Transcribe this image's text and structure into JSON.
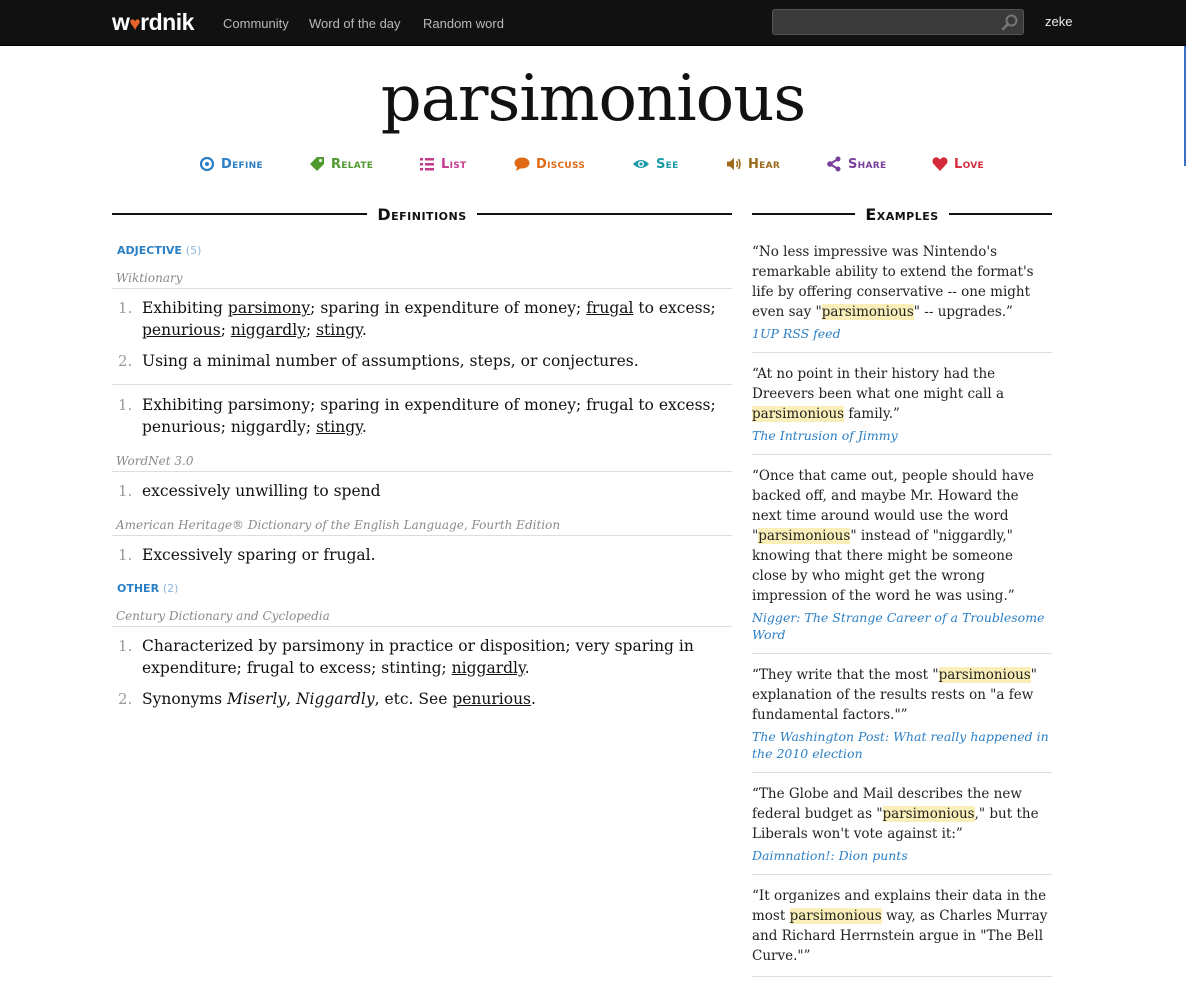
{
  "header": {
    "logo": {
      "pre": "w",
      "heart": "♥",
      "post": "rdnik"
    },
    "nav": [
      "Community",
      "Word of the day",
      "Random word"
    ],
    "search": {
      "value": "",
      "placeholder": ""
    },
    "user": "zeke"
  },
  "word": "parsimonious",
  "actions": [
    {
      "label": "Define",
      "icon": "target-icon",
      "color": "#2b7fc5"
    },
    {
      "label": "Relate",
      "icon": "tag-icon",
      "color": "#4f9a2e"
    },
    {
      "label": "List",
      "icon": "list-icon",
      "color": "#c43a8c"
    },
    {
      "label": "Discuss",
      "icon": "speech-bubble-icon",
      "color": "#e06a14"
    },
    {
      "label": "See",
      "icon": "eye-icon",
      "color": "#1a9aa5"
    },
    {
      "label": "Hear",
      "icon": "speaker-icon",
      "color": "#9b6a1c"
    },
    {
      "label": "Share",
      "icon": "share-icon",
      "color": "#7a3f9c"
    },
    {
      "label": "Love",
      "icon": "heart-icon",
      "color": "#d42a3a"
    }
  ],
  "definitions_heading": "Definitions",
  "examples_heading": "Examples",
  "definitions": {
    "adjective": {
      "pos": "adjective",
      "count": "(5)",
      "wiktionary": {
        "source": "Wiktionary",
        "group1": [
          {
            "num": "1.",
            "a": "Exhibiting ",
            "l1": "parsimony",
            "b": "; sparing in expenditure of money; ",
            "l2": "frugal",
            "c": " to excess; ",
            "l3": "penurious",
            "d": "; ",
            "l4": "niggardly",
            "e": "; ",
            "l5": "stingy",
            "f": "."
          },
          {
            "num": "2.",
            "text": "Using a minimal number of assumptions, steps, or conjectures."
          }
        ],
        "group2": [
          {
            "num": "1.",
            "a": "Exhibiting parsimony; sparing in expenditure of money; frugal to excess; penurious; niggardly; ",
            "l1": "stingy",
            "b": "."
          }
        ]
      },
      "wordnet": {
        "source": "WordNet 3.0",
        "items": [
          {
            "num": "1.",
            "text": "excessively unwilling to spend"
          }
        ]
      },
      "ahd": {
        "source": "American Heritage® Dictionary of the English Language, Fourth Edition",
        "items": [
          {
            "num": "1.",
            "text": "Excessively sparing or frugal."
          }
        ]
      }
    },
    "other": {
      "pos": "other",
      "count": "(2)",
      "century": {
        "source": "Century Dictionary and Cyclopedia",
        "item1": {
          "num": "1.",
          "a": "Characterized by parsimony in practice or disposition; very sparing in expenditure; frugal to excess; stinting; ",
          "l1": "niggardly",
          "b": "."
        },
        "item2": {
          "num": "2.",
          "a": "Synonyms ",
          "i1": "Miserly",
          "sep": ", ",
          "i2": "Niggardly",
          "b": ", etc. See ",
          "l1": "penurious",
          "c": "."
        }
      }
    }
  },
  "examples": [
    {
      "pre": "“No less impressive was Nintendo's remarkable ability to extend the format's life by offering conservative -- one might even say \"",
      "hl": "parsimonious",
      "post": "\" -- upgrades.”",
      "source": "1UP RSS feed"
    },
    {
      "pre": "“At no point in their history had the Dreevers been what one might call a ",
      "hl": "parsimonious",
      "post": " family.”",
      "source": "The Intrusion of Jimmy"
    },
    {
      "pre": "“Once that came out, people should have backed off, and maybe Mr. Howard the next time around would use the word \"",
      "hl": "parsimonious",
      "post": "\" instead of \"niggardly,\" knowing that there might be someone close by who might get the wrong impression of the word he was using.”",
      "source": "Nigger: The Strange Career of a Troublesome Word"
    },
    {
      "pre": "“They write that the most \"",
      "hl": "parsimonious",
      "post": "\" explanation of the results rests on \"a few fundamental factors.\"”",
      "source": "The Washington Post: What really happened in the 2010 election"
    },
    {
      "pre": "“The Globe and Mail describes the new federal budget as \"",
      "hl": "parsimonious",
      "post": ",\" but the Liberals won't vote against it:”",
      "source": "Daimnation!: Dion punts"
    },
    {
      "pre": "“It organizes and explains their data in the most ",
      "hl": "parsimonious",
      "post": " way, as Charles Murray and Richard Herrnstein argue in \"The Bell Curve.\"”",
      "source": ""
    }
  ]
}
